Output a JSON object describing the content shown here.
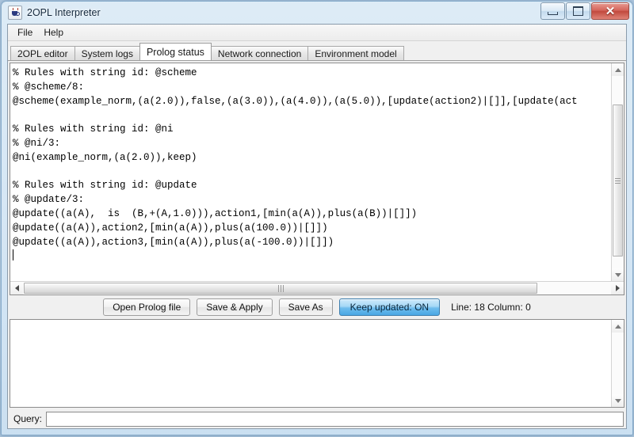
{
  "window": {
    "title": "2OPL Interpreter",
    "icon": "java-cup-icon",
    "controls": {
      "minimize": "–",
      "maximize": "□",
      "close": "✕"
    }
  },
  "menubar": {
    "items": [
      {
        "label": "File"
      },
      {
        "label": "Help"
      }
    ]
  },
  "tabs": {
    "active_index": 2,
    "items": [
      {
        "label": "2OPL editor"
      },
      {
        "label": "System logs"
      },
      {
        "label": "Prolog status"
      },
      {
        "label": "Network connection"
      },
      {
        "label": "Environment model"
      }
    ]
  },
  "editor": {
    "content": "% Rules with string id: @scheme\n% @scheme/8:\n@scheme(example_norm,(a(2.0)),false,(a(3.0)),(a(4.0)),(a(5.0)),[update(action2)|[]],[update(act\n\n% Rules with string id: @ni\n% @ni/3:\n@ni(example_norm,(a(2.0)),keep)\n\n% Rules with string id: @update\n% @update/3:\n@update((a(A),  is  (B,+(A,1.0))),action1,[min(a(A)),plus(a(B))|[]])\n@update((a(A)),action2,[min(a(A)),plus(a(100.0))|[]])\n@update((a(A)),action3,[min(a(A)),plus(a(-100.0))|[]])\n"
  },
  "toolbar": {
    "open_label": "Open Prolog file",
    "save_apply_label": "Save & Apply",
    "save_as_label": "Save As",
    "keep_updated_label": "Keep updated:  ON",
    "caret_status": "Line: 18 Column: 0"
  },
  "output": {
    "content": ""
  },
  "query": {
    "label": "Query:",
    "value": "",
    "placeholder": ""
  },
  "colors": {
    "accent_blue": "#4aa7e3",
    "close_red": "#c14a3e",
    "window_bg": "#f0f0f0",
    "text": "#000000"
  }
}
